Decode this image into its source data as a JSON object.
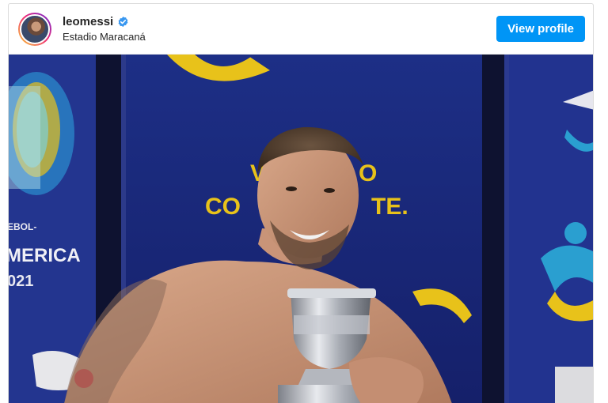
{
  "post": {
    "username": "leomessi",
    "location": "Estadio Maracaná",
    "view_profile_label": "View profile"
  },
  "icons": {
    "verified": "verified-badge-icon",
    "avatar": "profile-avatar"
  },
  "photo_text": {
    "banner_line1": "V",
    "banner_line1b": "O",
    "banner_line2": "CO",
    "banner_line2b": "TE.",
    "side_line1": "EBOL-",
    "side_line2": "MERICA",
    "side_line3": "021"
  },
  "colors": {
    "button_bg": "#0095f6",
    "verified_blue": "#3897f0",
    "backdrop_blue": "#1b2a78",
    "accent_yellow": "#e8c21a"
  }
}
